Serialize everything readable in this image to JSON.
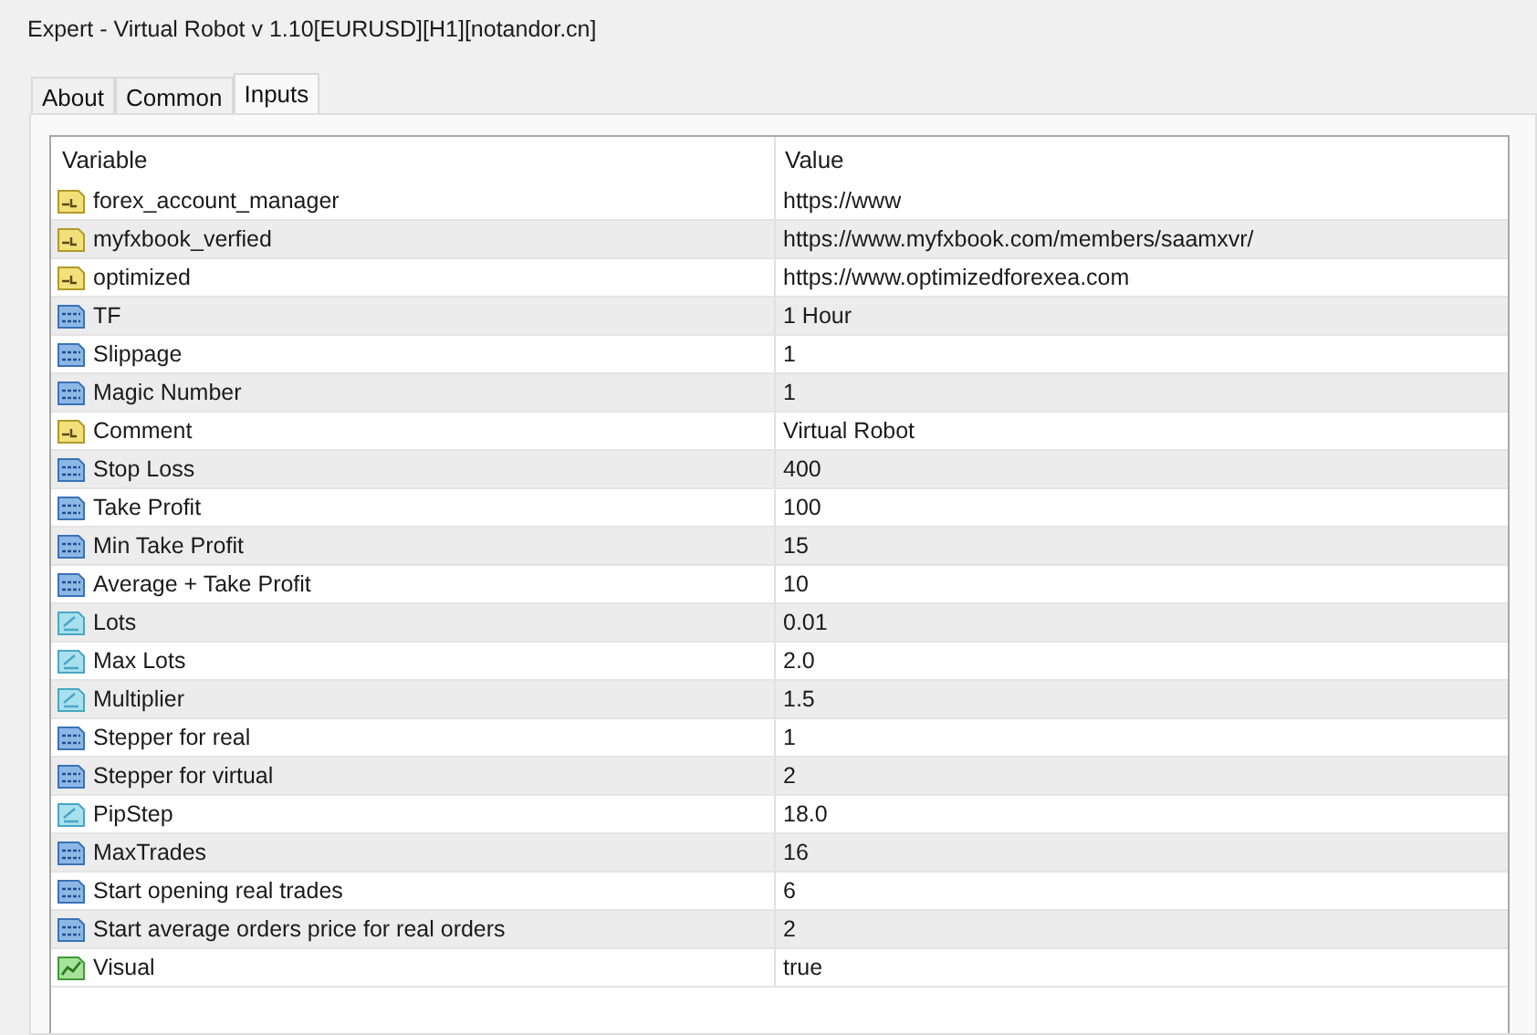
{
  "window": {
    "title": "Expert - Virtual Robot v 1.10[EURUSD][H1][notandor.cn]"
  },
  "tabs": [
    {
      "label": "About",
      "selected": false
    },
    {
      "label": "Common",
      "selected": false
    },
    {
      "label": "Inputs",
      "selected": true
    }
  ],
  "table": {
    "columns": [
      "Variable",
      "Value"
    ],
    "rows": [
      {
        "kind": "string",
        "variable": "forex_account_manager",
        "value": "https://www"
      },
      {
        "kind": "string",
        "variable": "myfxbook_verfied",
        "value": "https://www.myfxbook.com/members/saamxvr/"
      },
      {
        "kind": "string",
        "variable": "optimized",
        "value": "https://www.optimizedforexea.com"
      },
      {
        "kind": "int",
        "variable": "TF",
        "value": "1 Hour"
      },
      {
        "kind": "int",
        "variable": "Slippage",
        "value": "1"
      },
      {
        "kind": "int",
        "variable": "Magic Number",
        "value": "1"
      },
      {
        "kind": "string",
        "variable": "Comment",
        "value": "Virtual Robot"
      },
      {
        "kind": "int",
        "variable": "Stop Loss",
        "value": "400"
      },
      {
        "kind": "int",
        "variable": "Take Profit",
        "value": "100"
      },
      {
        "kind": "int",
        "variable": "Min Take Profit",
        "value": "15"
      },
      {
        "kind": "int",
        "variable": "Average + Take Profit",
        "value": "10"
      },
      {
        "kind": "double",
        "variable": "Lots",
        "value": "0.01"
      },
      {
        "kind": "double",
        "variable": "Max Lots",
        "value": "2.0"
      },
      {
        "kind": "double",
        "variable": "Multiplier",
        "value": "1.5"
      },
      {
        "kind": "int",
        "variable": "Stepper for real",
        "value": "1"
      },
      {
        "kind": "int",
        "variable": "Stepper for virtual",
        "value": "2"
      },
      {
        "kind": "double",
        "variable": "PipStep",
        "value": "18.0"
      },
      {
        "kind": "int",
        "variable": "MaxTrades",
        "value": "16"
      },
      {
        "kind": "int",
        "variable": "Start opening real trades",
        "value": "6"
      },
      {
        "kind": "int",
        "variable": "Start average orders price for real orders",
        "value": "2"
      },
      {
        "kind": "bool",
        "variable": "Visual",
        "value": "true"
      }
    ]
  }
}
